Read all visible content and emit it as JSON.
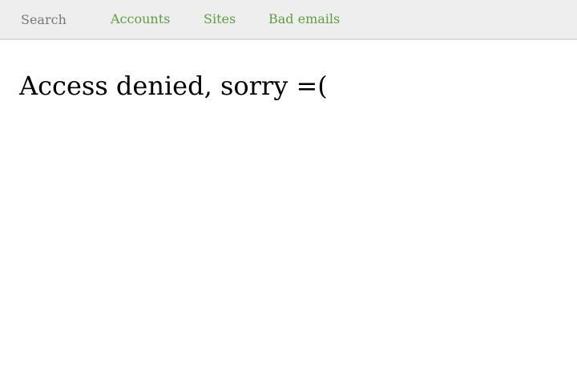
{
  "colors": {
    "nav_link": "#5f9e3f",
    "topbar_bg": "#eeeeee",
    "placeholder": "#777777",
    "title": "#000000"
  },
  "search": {
    "placeholder": "Search",
    "value": ""
  },
  "nav": {
    "items": [
      {
        "label": "Accounts"
      },
      {
        "label": "Sites"
      },
      {
        "label": "Bad emails"
      }
    ]
  },
  "main": {
    "title": "Access denied, sorry =("
  }
}
